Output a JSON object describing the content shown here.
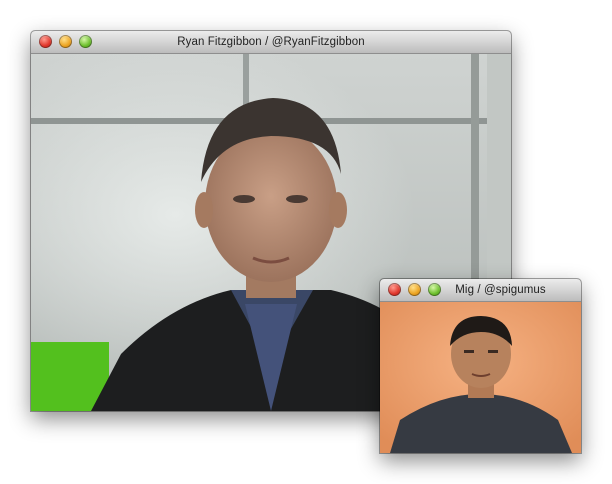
{
  "main_window": {
    "title": "Ryan Fitzgibbon / @RyanFitzgibbon"
  },
  "pip_window": {
    "title": "Mig / @spigumus"
  },
  "icons": {
    "close": "close-button-icon",
    "minimize": "minimize-button-icon",
    "zoom": "zoom-button-icon"
  },
  "colors": {
    "close": "#e0352a",
    "minimize": "#eca321",
    "zoom": "#6cbf2c",
    "pip_background": "#f0a06a"
  }
}
